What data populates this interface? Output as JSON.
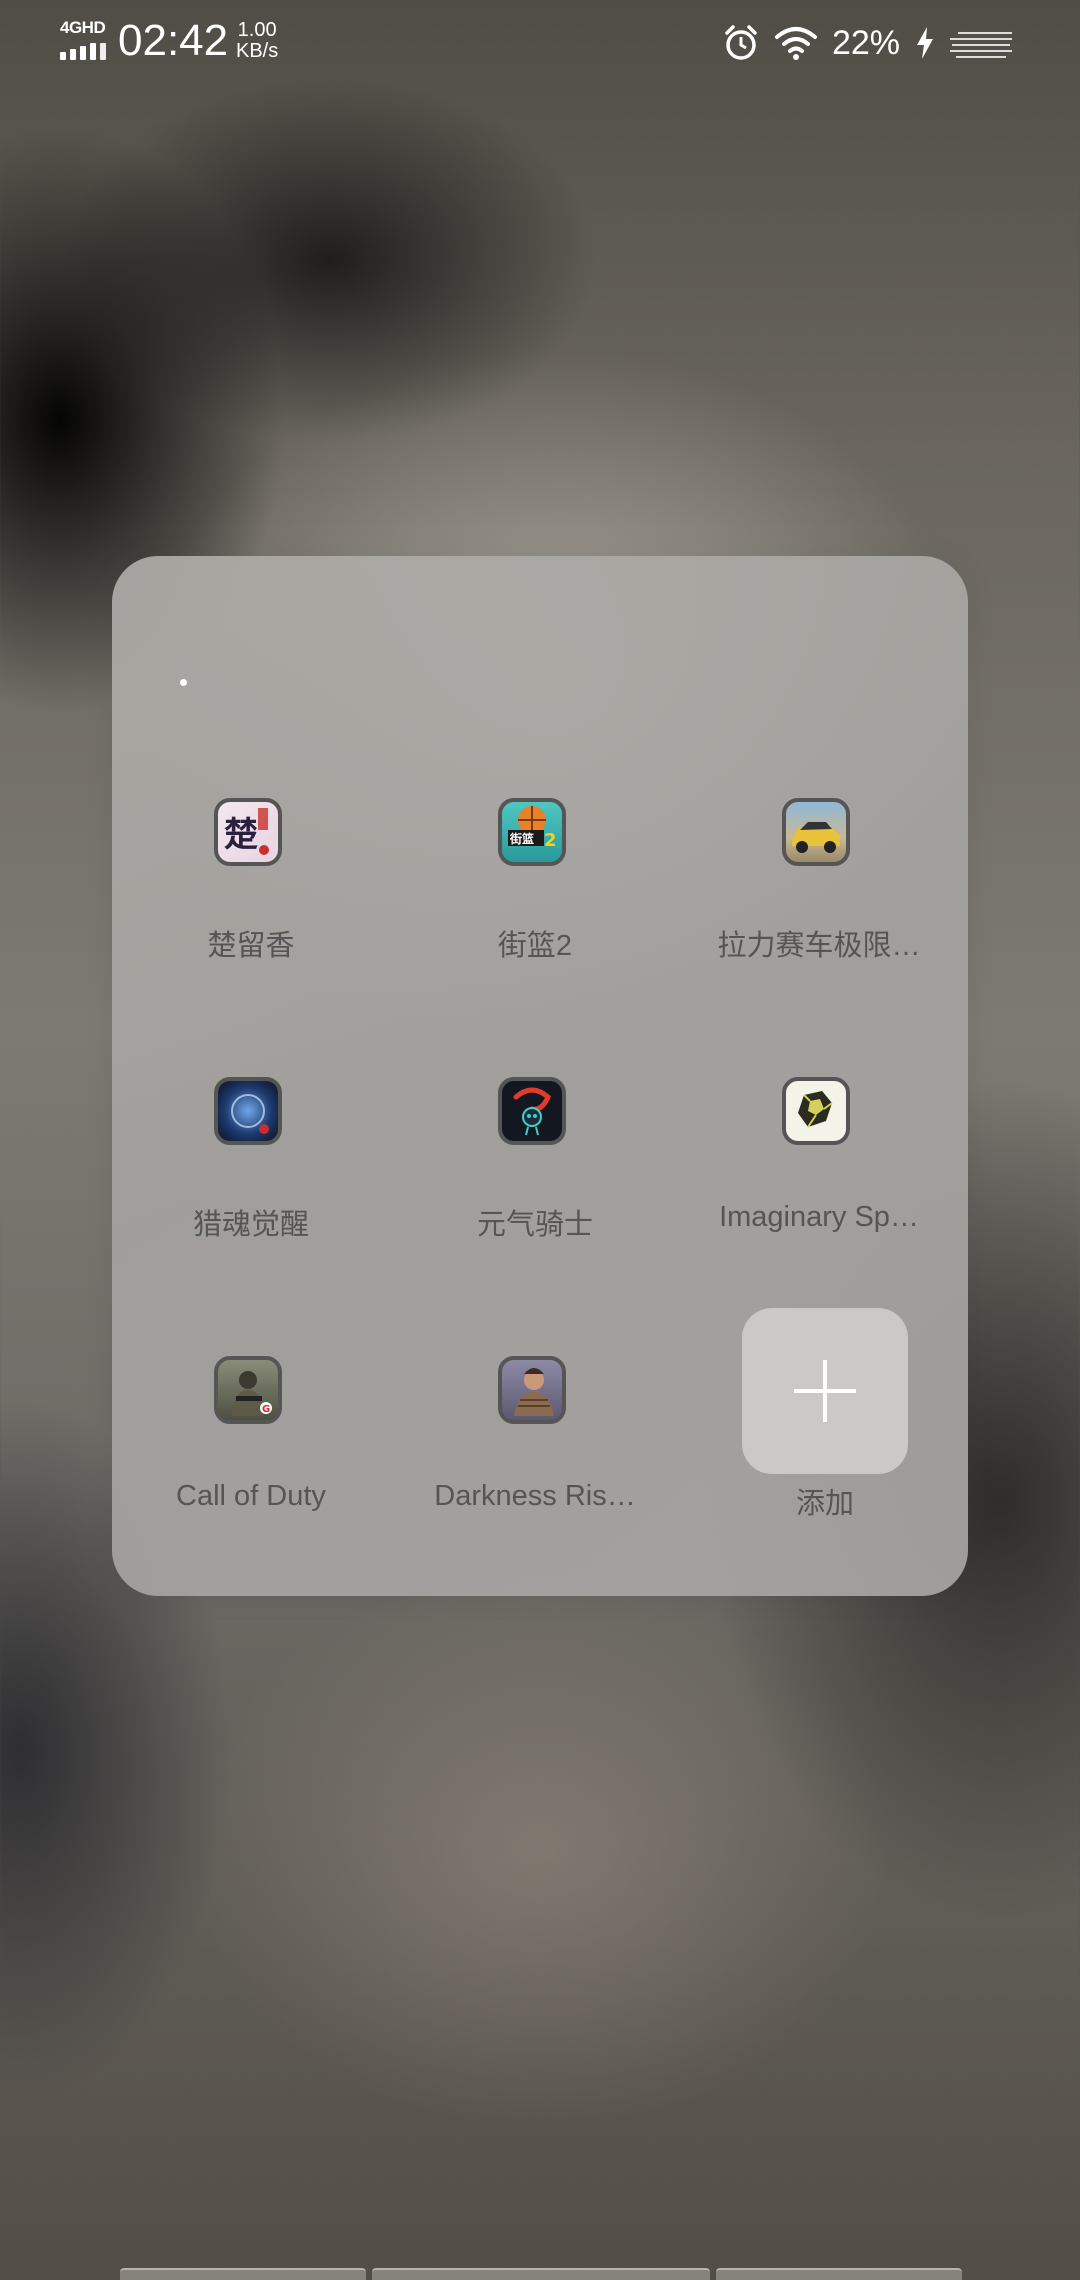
{
  "status_bar": {
    "network_type": "4GHD",
    "time": "02:42",
    "net_speed_value": "1.00",
    "net_speed_unit": "KB/s",
    "battery_percent": "22%",
    "icons": [
      "signal-icon",
      "alarm-icon",
      "wifi-icon",
      "charging-icon",
      "menu-lines-icon"
    ]
  },
  "folder": {
    "apps": [
      {
        "label": "楚留香",
        "icon": "chuliuxiang-icon"
      },
      {
        "label": "街篮2",
        "icon": "street-basketball-icon"
      },
      {
        "label": "拉力赛车极限…",
        "icon": "rally-car-icon"
      },
      {
        "label": "猎魂觉醒",
        "icon": "soul-hunter-icon"
      },
      {
        "label": "元气骑士",
        "icon": "soul-knight-icon"
      },
      {
        "label": "Imaginary Sp…",
        "icon": "imaginary-space-icon"
      },
      {
        "label": "Call of Duty",
        "icon": "call-of-duty-icon"
      },
      {
        "label": "Darkness Ris…",
        "icon": "darkness-rises-icon"
      }
    ],
    "add_label": "添加"
  },
  "colors": {
    "folder_bg": "#aaa8a5",
    "label_text": "#555555",
    "status_text": "#ffffff"
  }
}
